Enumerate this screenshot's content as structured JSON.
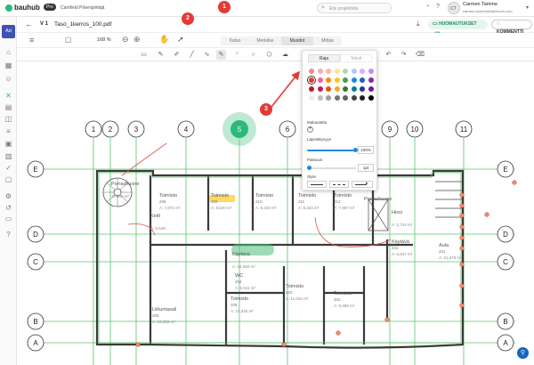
{
  "app": {
    "logo": "bauhub",
    "badge": "Pro",
    "project": "Camfield Pilvenpiirtäjä",
    "search_placeholder": "Etsi projektista",
    "user_name": "Carmen Tamme",
    "user_email": "carmen.tamme@admicom.com",
    "user_initials": "CT",
    "nav_initials": "Ad"
  },
  "file": {
    "version": "V 1",
    "name": "Taso_1kerros_100.pdf",
    "comments_label": "HUOMAUTUKSET",
    "comments_count": "0",
    "comment_btn": "KOMMENTTI"
  },
  "viewer": {
    "zoom": "168 %",
    "tabs": [
      "Katso",
      "Merkitse",
      "Muodot",
      "Mittaa"
    ],
    "active_tab": "Muodot"
  },
  "panel": {
    "tabs": [
      "Raja",
      "Teksti"
    ],
    "custom_label": "Mukautettu",
    "opacity_label": "Läpinäkyvyys",
    "opacity_value": "100%",
    "opacity": 1.0,
    "thickness_label": "Paksuus",
    "thickness_value": "1pt",
    "style_label": "Style",
    "colors": [
      "#f28b82",
      "#f7a8c4",
      "#fbbc9a",
      "#fde293",
      "#a8dab5",
      "#aecbfa",
      "#d7aefb",
      "#c58af9",
      "#e53935",
      "#f06292",
      "#fb8c00",
      "#fbc02d",
      "#43a047",
      "#1e88e5",
      "#1565c0",
      "#8e24aa",
      "#b71c1c",
      "#c2185b",
      "#e65100",
      "#f9a825",
      "#2e7d32",
      "#00838f",
      "#283593",
      "#6a1b9a",
      "#eeeeee",
      "#bdbdbd",
      "#9e9e9e",
      "#757575",
      "#616161",
      "#424242",
      "#212121",
      "#000000"
    ]
  },
  "callouts": [
    "1",
    "2",
    "3"
  ],
  "plan": {
    "axes_top": [
      "1",
      "2",
      "3",
      "4",
      "5",
      "6",
      "9",
      "10",
      "11"
    ],
    "axes_side": [
      "E",
      "D",
      "C",
      "B",
      "A"
    ],
    "rooms": [
      {
        "name": "Porrashuone",
        "num": "",
        "area": "11.939 m²"
      },
      {
        "name": "Toimisto",
        "num": "208",
        "area": "A: 7,871 m²"
      },
      {
        "name": "Toimisto",
        "num": "209",
        "area": "A: 8,520 m²"
      },
      {
        "name": "Toimisto",
        "num": "210",
        "area": "A: 8,343 m²"
      },
      {
        "name": "Toimisto",
        "num": "211",
        "area": "A: 8,343 m²"
      },
      {
        "name": "Toimisto",
        "num": "212",
        "area": "A: 7,967 m²"
      },
      {
        "name": "Porrashuone",
        "num": "",
        "area": ""
      },
      {
        "name": "Hissi",
        "num": "",
        "area": "A: 2,734 m²"
      },
      {
        "name": "Käytävä",
        "num": "241",
        "area": "A: 6,637 m²"
      },
      {
        "name": "Aula",
        "num": "201",
        "area": "A: 21,679 m²"
      },
      {
        "name": "Käytävä",
        "num": "",
        "area": "A: 24,092 m²"
      },
      {
        "name": "WC",
        "num": "204",
        "area": "A: 6,911 m²"
      },
      {
        "name": "Liikuntasali",
        "num": "206",
        "area": "A: 19,286 m²"
      },
      {
        "name": "Toimisto",
        "num": "205",
        "area": "A: 16,345 m²"
      },
      {
        "name": "Toimisto",
        "num": "203",
        "area": "A: 11,033 m²"
      },
      {
        "name": "Toimisto",
        "num": "202",
        "area": "A: 9,496 m²"
      },
      {
        "name": "Keitt",
        "num": "",
        "area": "A: 9,648"
      }
    ]
  }
}
